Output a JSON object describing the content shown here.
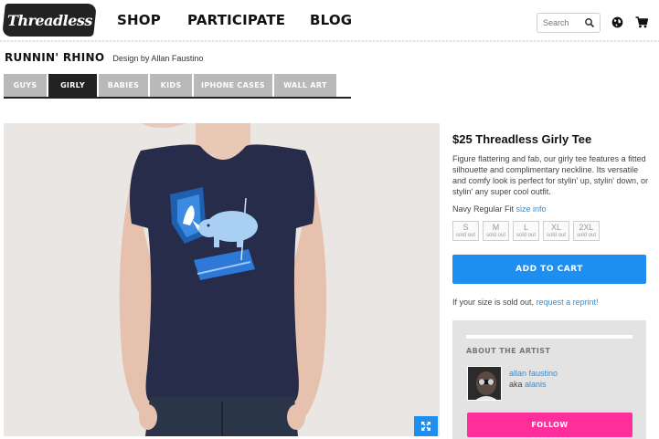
{
  "header": {
    "logo_text": "Threadless",
    "nav": [
      "SHOP",
      "PARTICIPATE",
      "BLOG"
    ],
    "search_placeholder": "Search",
    "icons": {
      "search": "search-icon",
      "globe": "globe-icon",
      "cart": "cart-icon"
    }
  },
  "design": {
    "title": "RUNNIN' RHINO",
    "by": "Design by Allan Faustino"
  },
  "tabs": [
    {
      "label": "GUYS",
      "active": false
    },
    {
      "label": "GIRLY",
      "active": true
    },
    {
      "label": "BABIES",
      "active": false
    },
    {
      "label": "KIDS",
      "active": false
    },
    {
      "label": "IPHONE CASES",
      "active": false
    },
    {
      "label": "WALL ART",
      "active": false
    }
  ],
  "product": {
    "price_title": "$25 Threadless Girly Tee",
    "description": "Figure flattering and fab, our girly tee features a fitted silhouette and complimentary neckline. Its versatile and comfy look is perfect for stylin' up, stylin' down, or stylin' any super cool outfit.",
    "fit_prefix": "Navy Regular Fit",
    "size_info_link": "size info",
    "sizes": [
      {
        "label": "S",
        "status": "sold out"
      },
      {
        "label": "M",
        "status": "sold out"
      },
      {
        "label": "L",
        "status": "sold out"
      },
      {
        "label": "XL",
        "status": "sold out"
      },
      {
        "label": "2XL",
        "status": "sold out"
      }
    ],
    "add_to_cart": "ADD TO CART",
    "reprint_prefix": "If your size is sold out,",
    "reprint_link": "request a reprint!"
  },
  "artist": {
    "heading": "ABOUT THE ARTIST",
    "name": "allan faustino",
    "aka_prefix": "aka",
    "aka_link": "alanis",
    "follow": "FOLLOW"
  },
  "colors": {
    "accent_blue": "#1e8ff0",
    "follow_pink": "#ff2e9b",
    "tab_active": "#222222",
    "tab_inactive": "#b9b9b9",
    "shirt_navy": "#262c4a"
  }
}
